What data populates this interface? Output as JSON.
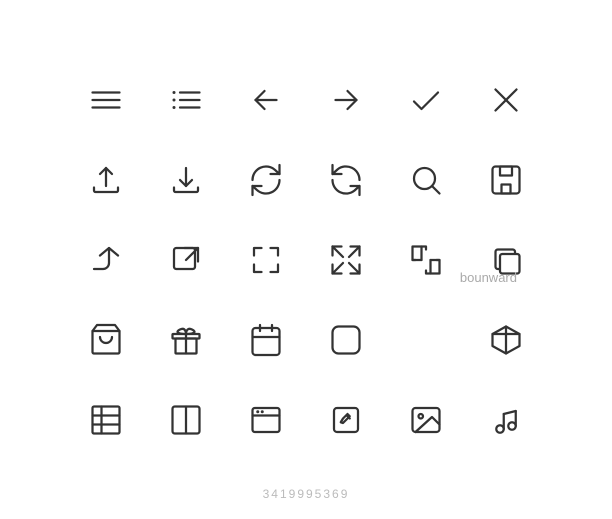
{
  "watermark": "bounward",
  "getty_id": "3419995369",
  "icons": [
    {
      "name": "hamburger-menu",
      "row": 1,
      "col": 1
    },
    {
      "name": "list-menu",
      "row": 1,
      "col": 2
    },
    {
      "name": "arrow-left",
      "row": 1,
      "col": 3
    },
    {
      "name": "arrow-right",
      "row": 1,
      "col": 4
    },
    {
      "name": "checkmark",
      "row": 1,
      "col": 5
    },
    {
      "name": "close-x",
      "row": 1,
      "col": 6
    },
    {
      "name": "upload",
      "row": 2,
      "col": 1
    },
    {
      "name": "download",
      "row": 2,
      "col": 2
    },
    {
      "name": "refresh-cw",
      "row": 2,
      "col": 3
    },
    {
      "name": "refresh-ccw",
      "row": 2,
      "col": 4
    },
    {
      "name": "search",
      "row": 2,
      "col": 5
    },
    {
      "name": "save-floppy",
      "row": 2,
      "col": 6
    },
    {
      "name": "share-forward",
      "row": 3,
      "col": 1
    },
    {
      "name": "external-link",
      "row": 3,
      "col": 2
    },
    {
      "name": "expand-small",
      "row": 3,
      "col": 3
    },
    {
      "name": "expand-full",
      "row": 3,
      "col": 4
    },
    {
      "name": "compress",
      "row": 3,
      "col": 5
    },
    {
      "name": "layers",
      "row": 3,
      "col": 6
    },
    {
      "name": "shopping-bag",
      "row": 4,
      "col": 1
    },
    {
      "name": "gift",
      "row": 4,
      "col": 2
    },
    {
      "name": "calendar",
      "row": 4,
      "col": 3
    },
    {
      "name": "rounded-square",
      "row": 4,
      "col": 4
    },
    {
      "name": "cube-3d",
      "row": 4,
      "col": 6
    },
    {
      "name": "table-grid",
      "row": 5,
      "col": 1
    },
    {
      "name": "panel-layout",
      "row": 5,
      "col": 2
    },
    {
      "name": "browser-window",
      "row": 5,
      "col": 3
    },
    {
      "name": "edit-pen",
      "row": 5,
      "col": 4
    },
    {
      "name": "image-photo",
      "row": 5,
      "col": 5
    },
    {
      "name": "music-note",
      "row": 5,
      "col": 6
    }
  ]
}
